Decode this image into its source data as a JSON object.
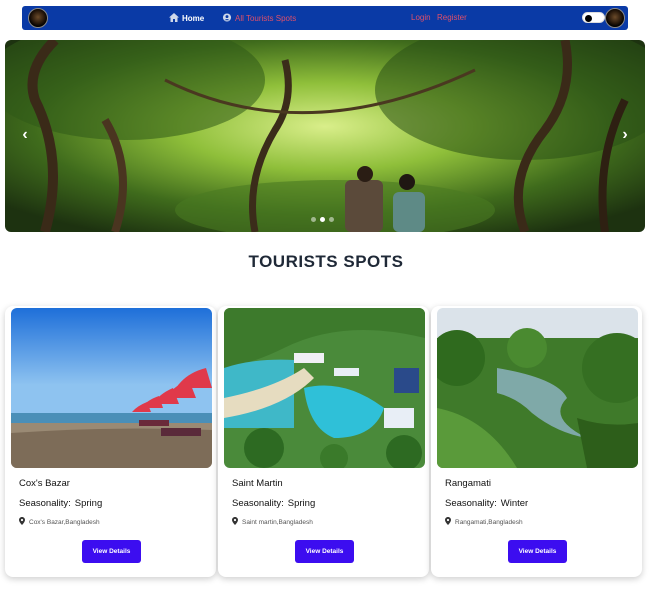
{
  "nav": {
    "home_label": "Home",
    "spots_label": "All Tourists Spots",
    "login_label": "Login",
    "register_label": "Register",
    "colors": {
      "bar": "#0a3aa6",
      "active": "#ffffff",
      "link": "#e0506a"
    }
  },
  "hero": {
    "prev_symbol": "‹",
    "next_symbol": "›",
    "slides": 3,
    "active_slide": 2
  },
  "section": {
    "title": "TOURISTS SPOTS"
  },
  "cards": [
    {
      "name": "Cox's Bazar",
      "season_label": "Seasonality:",
      "season": "Spring",
      "location": "Cox's Bazar,Bangladesh",
      "button": "View Details"
    },
    {
      "name": "Saint Martin",
      "season_label": "Seasonality:",
      "season": "Spring",
      "location": "Saint martin,Bangladesh",
      "button": "View Details"
    },
    {
      "name": "Rangamati",
      "season_label": "Seasonality:",
      "season": "Winter",
      "location": "Rangamati,Bangladesh",
      "button": "View Details"
    }
  ],
  "accent": "#3c0df0"
}
